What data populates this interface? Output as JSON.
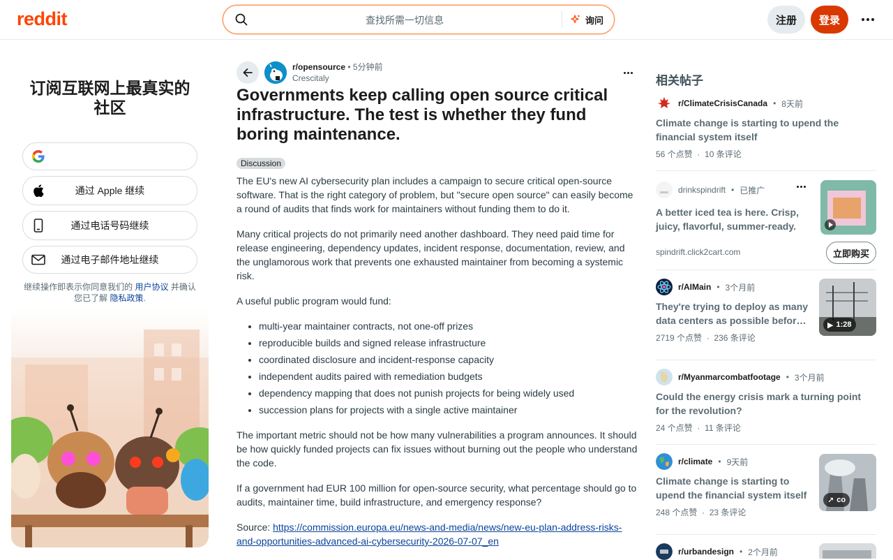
{
  "header": {
    "logo": "reddit",
    "search_placeholder": "查找所需一切信息",
    "ask_label": "询问",
    "signup_label": "注册",
    "login_label": "登录"
  },
  "signup_card": {
    "title": "订阅互联网上最真实的社区",
    "apple_label": "通过 Apple 继续",
    "phone_label": "通过电话号码继续",
    "email_label": "通过电子邮件地址继续",
    "legal_prefix": "继续操作即表示你同意我们的",
    "user_agreement": "用户协议",
    "legal_middle": "并确认您已了解",
    "privacy_policy": "隐私政策",
    "legal_suffix": "."
  },
  "post": {
    "subreddit": "r/opensource",
    "time": "5分钟前",
    "author": "Crescitaly",
    "title": "Governments keep calling open source critical infrastructure. The test is whether they fund boring maintenance.",
    "flair": "Discussion",
    "p1": "The EU's new AI cybersecurity plan includes a campaign to secure critical open-source software. That is the right category of problem, but \"secure open source\" can easily become a round of audits that finds work for maintainers without funding them to do it.",
    "p2": "Many critical projects do not primarily need another dashboard. They need paid time for release engineering, dependency updates, incident response, documentation, review, and the unglamorous work that prevents one exhausted maintainer from becoming a systemic risk.",
    "p3": "A useful public program would fund:",
    "list": [
      "multi-year maintainer contracts, not one-off prizes",
      "reproducible builds and signed release infrastructure",
      "coordinated disclosure and incident-response capacity",
      "independent audits paired with remediation budgets",
      "dependency mapping that does not punish projects for being widely used",
      "succession plans for projects with a single active maintainer"
    ],
    "p4": "The important metric should not be how many vulnerabilities a program announces. It should be how quickly funded projects can fix issues without burning out the people who understand the code.",
    "p5": "If a government had EUR 100 million for open-source security, what percentage should go to audits, maintainer time, build infrastructure, and emergency response?",
    "source_label": "Source:",
    "source_url": "https://commission.europa.eu/news-and-media/news/new-eu-plan-address-risks-and-opportunities-advanced-ai-cybersecurity-2026-07-07_en"
  },
  "related": {
    "title": "相关帖子",
    "items": [
      {
        "sub": "r/ClimateCrisisCanada",
        "time": "8天前",
        "title": "Climate change is starting to upend the financial system itself",
        "votes": "56 个点赞",
        "comments": "10 条评论"
      },
      {
        "sub": "drinkspindrift",
        "time": "已推广",
        "title": "A better iced tea is here. Crisp, juicy, flavorful, summer-ready.",
        "domain": "spindrift.click2cart.com",
        "cta": "立即购买"
      },
      {
        "sub": "r/AIMain",
        "time": "3个月前",
        "title": "They're trying to deploy as many data centers as possible befor…",
        "votes": "2719 个点赞",
        "comments": "236 条评论",
        "badge": "1:28"
      },
      {
        "sub": "r/Myanmarcombatfootage",
        "time": "3个月前",
        "title": "Could the energy crisis mark a turning point for the revolution?",
        "votes": "24 个点赞",
        "comments": "11 条评论"
      },
      {
        "sub": "r/climate",
        "time": "9天前",
        "title": "Climate change is starting to upend the financial system itself",
        "votes": "248 个点赞",
        "comments": "23 条评论",
        "badge": "co"
      },
      {
        "sub": "r/urbandesign",
        "time": "2个月前"
      }
    ]
  },
  "colors": {
    "brand": "#ff4500",
    "login": "#d93900",
    "link": "#0a449b"
  }
}
